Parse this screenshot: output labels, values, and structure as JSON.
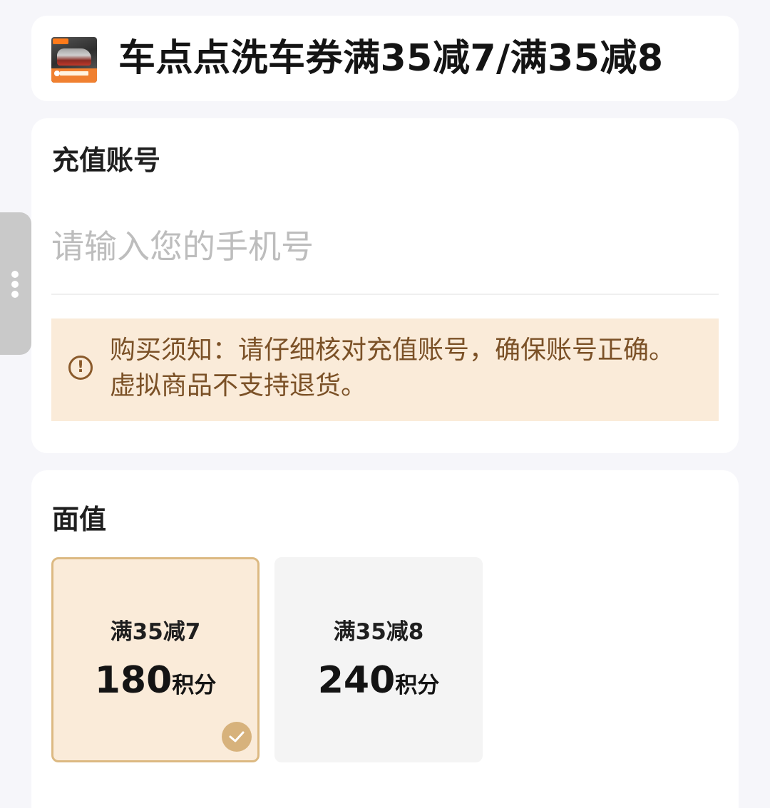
{
  "product": {
    "title": "车点点洗车券满35减7/满35减8",
    "thumbnail_icon": "car-wash-thumbnail"
  },
  "account": {
    "section_title": "充值账号",
    "phone_placeholder": "请输入您的手机号",
    "phone_value": "",
    "notice": "购买须知：请仔细核对充值账号，确保账号正确。虚拟商品不支持退货。",
    "notice_icon": "info-circle-icon"
  },
  "face_value": {
    "section_title": "面值",
    "options": [
      {
        "label": "满35减7",
        "points": "180",
        "unit": "积分",
        "selected": true
      },
      {
        "label": "满35减8",
        "points": "240",
        "unit": "积分",
        "selected": false
      }
    ]
  },
  "colors": {
    "page_bg": "#f6f6fa",
    "notice_bg": "#faebd9",
    "notice_text": "#7b5127",
    "selected_border": "#dcb982",
    "check_badge": "#d7b27c",
    "unselected_bg": "#f4f4f4"
  }
}
